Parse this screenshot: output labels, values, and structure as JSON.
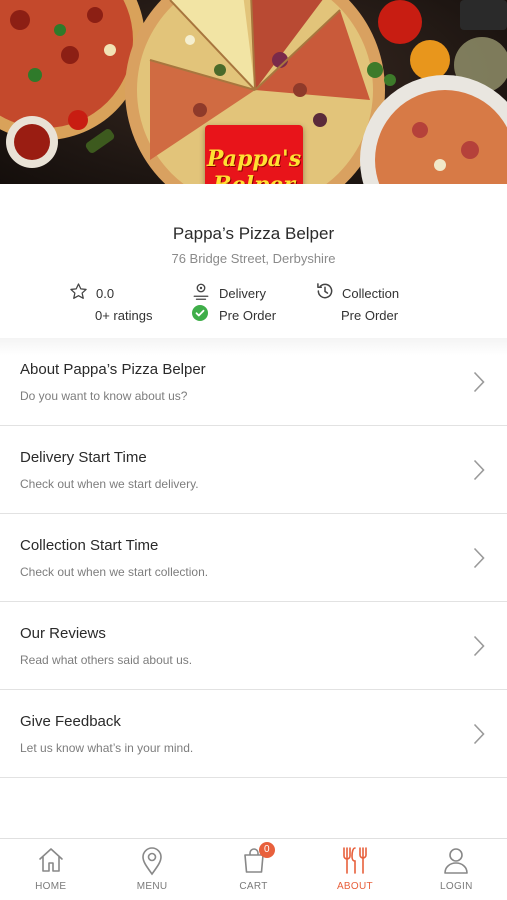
{
  "store": {
    "logo_line1": "Pappa's",
    "logo_line2": "Belper",
    "name": "Pappa’s Pizza Belper",
    "address": "76 Bridge Street, Derbyshire"
  },
  "stats": {
    "rating_value": "0.0",
    "rating_count": "0+ ratings",
    "delivery_label": "Delivery",
    "delivery_status": "Pre Order",
    "collection_label": "Collection",
    "collection_status": "Pre Order"
  },
  "menu": [
    {
      "title": "About Pappa’s Pizza Belper",
      "subtitle": "Do you want to know about us?"
    },
    {
      "title": "Delivery Start Time",
      "subtitle": "Check out when we start delivery."
    },
    {
      "title": "Collection Start Time",
      "subtitle": "Check out when we start collection."
    },
    {
      "title": "Our Reviews",
      "subtitle": "Read what others said about us."
    },
    {
      "title": "Give Feedback",
      "subtitle": "Let us know what’s in your mind."
    }
  ],
  "tabs": [
    {
      "label": "HOME",
      "icon": "home-icon"
    },
    {
      "label": "MENU",
      "icon": "map-pin-icon"
    },
    {
      "label": "CART",
      "icon": "shopping-bag-icon",
      "badge": "0"
    },
    {
      "label": "ABOUT",
      "icon": "cutlery-icon",
      "active": true
    },
    {
      "label": "LOGIN",
      "icon": "user-icon"
    }
  ],
  "colors": {
    "accent": "#e8603c",
    "logo_bg": "#e8141a",
    "logo_text": "#ffe033",
    "check_green": "#3fae49"
  }
}
